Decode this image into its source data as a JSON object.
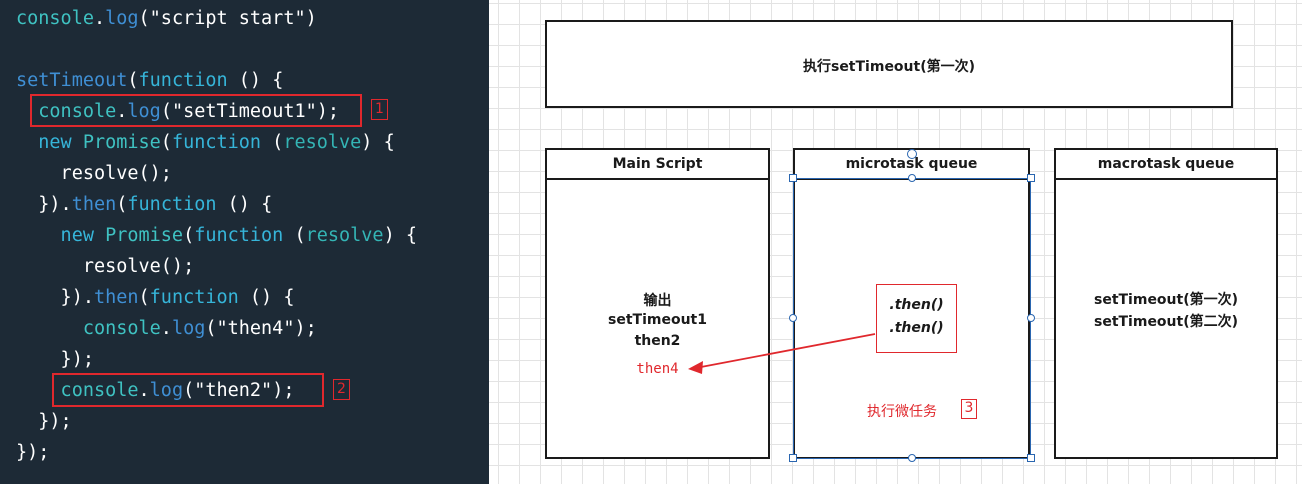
{
  "code": {
    "lines": [
      [
        {
          "t": "console",
          "c": "cls"
        },
        {
          "t": ".",
          "c": "plain"
        },
        {
          "t": "log",
          "c": "fn"
        },
        {
          "t": "(\"script start\")",
          "c": "plain"
        }
      ],
      [],
      [
        {
          "t": "setTimeout",
          "c": "fn"
        },
        {
          "t": "(",
          "c": "plain"
        },
        {
          "t": "function",
          "c": "key"
        },
        {
          "t": " () {",
          "c": "plain"
        }
      ],
      [
        {
          "t": "  console",
          "c": "cls"
        },
        {
          "t": ".",
          "c": "plain"
        },
        {
          "t": "log",
          "c": "fn"
        },
        {
          "t": "(\"setTimeout1\");",
          "c": "plain"
        }
      ],
      [
        {
          "t": "  new ",
          "c": "key"
        },
        {
          "t": "Promise",
          "c": "cls"
        },
        {
          "t": "(",
          "c": "plain"
        },
        {
          "t": "function",
          "c": "key"
        },
        {
          "t": " (",
          "c": "plain"
        },
        {
          "t": "resolve",
          "c": "param"
        },
        {
          "t": ") {",
          "c": "plain"
        }
      ],
      [
        {
          "t": "    resolve();",
          "c": "plain"
        }
      ],
      [
        {
          "t": "  }).",
          "c": "plain"
        },
        {
          "t": "then",
          "c": "fn"
        },
        {
          "t": "(",
          "c": "plain"
        },
        {
          "t": "function",
          "c": "key"
        },
        {
          "t": " () {",
          "c": "plain"
        }
      ],
      [
        {
          "t": "    new ",
          "c": "key"
        },
        {
          "t": "Promise",
          "c": "cls"
        },
        {
          "t": "(",
          "c": "plain"
        },
        {
          "t": "function",
          "c": "key"
        },
        {
          "t": " (",
          "c": "plain"
        },
        {
          "t": "resolve",
          "c": "param"
        },
        {
          "t": ") {",
          "c": "plain"
        }
      ],
      [
        {
          "t": "      resolve();",
          "c": "plain"
        }
      ],
      [
        {
          "t": "    }).",
          "c": "plain"
        },
        {
          "t": "then",
          "c": "fn"
        },
        {
          "t": "(",
          "c": "plain"
        },
        {
          "t": "function",
          "c": "key"
        },
        {
          "t": " () {",
          "c": "plain"
        }
      ],
      [
        {
          "t": "      console",
          "c": "cls"
        },
        {
          "t": ".",
          "c": "plain"
        },
        {
          "t": "log",
          "c": "fn"
        },
        {
          "t": "(\"then4\");",
          "c": "plain"
        }
      ],
      [
        {
          "t": "    });",
          "c": "plain"
        }
      ],
      [
        {
          "t": "    console",
          "c": "cls"
        },
        {
          "t": ".",
          "c": "plain"
        },
        {
          "t": "log",
          "c": "fn"
        },
        {
          "t": "(\"then2\");",
          "c": "plain"
        }
      ],
      [
        {
          "t": "  });",
          "c": "plain"
        }
      ],
      [
        {
          "t": "});",
          "c": "plain"
        }
      ]
    ],
    "markers": [
      "1",
      "2"
    ]
  },
  "diagram": {
    "top_label": "执行setTimeout(第一次)",
    "main_script": {
      "header": "Main Script",
      "lines": [
        "输出",
        "setTimeout1",
        "then2"
      ],
      "highlight": "then4"
    },
    "microtask": {
      "header": "microtask queue",
      "items": [
        ".then()",
        ".then()"
      ],
      "action": "执行微任务",
      "marker": "3"
    },
    "macrotask": {
      "header": "macrotask queue",
      "items": [
        "setTimeout(第一次)",
        "setTimeout(第二次)"
      ]
    }
  },
  "colors": {
    "code_bg": "#1d2a36",
    "accent_red": "#e0282d",
    "selection_blue": "#2a66b0"
  }
}
